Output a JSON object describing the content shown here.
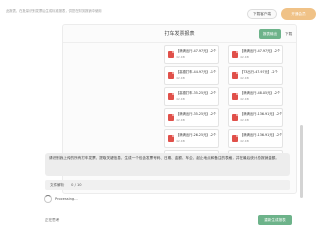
{
  "notice": "此报表，在批量识别发票后生成标准报表，供您在财务报销中使用",
  "header": {
    "download_label": "下载客户端",
    "member_label": "开通会员"
  },
  "panel": {
    "title": "打车发票报表",
    "tabs": {
      "output": "报表输出",
      "download": "下载"
    }
  },
  "files": [
    {
      "name": "【滴滴出行-47.97元】-2个",
      "size": "42.KB"
    },
    {
      "name": "【滴滴出行-47.97元】-2个",
      "size": "42.KB"
    },
    {
      "name": "【高德打车-44.97元】-1个",
      "size": "42.KB"
    },
    {
      "name": "【T3出行-47.97元】-2个",
      "size": "42.KB"
    },
    {
      "name": "【高德打车-35.25元】-2个",
      "size": "42.KB"
    },
    {
      "name": "【滴滴出行-48.05元】-2个",
      "size": "42.KB"
    },
    {
      "name": "【滴滴出行-35.25元】-2个",
      "size": "42.KB"
    },
    {
      "name": "【滴滴出行-136.91元】-2个",
      "size": "42.KB"
    },
    {
      "name": "【滴滴出行-26.25元】-2个",
      "size": "42.KB"
    },
    {
      "name": "【滴滴出行-136.91元】-2个",
      "size": "42.KB"
    },
    {
      "name": "【滴滴出行-47.77元】-2个",
      "size": "42.KB"
    },
    {
      "name": "【滴滴出行-48.77元】-2个",
      "size": "42.KB"
    }
  ],
  "chat": {
    "prompt": "请识别我上传的所有打车发票，提取关键信息，生成一个包含发票号码、日期、金额、车企、起止地点和备注的表格，并在最后统计总报销金额。"
  },
  "progress": {
    "label": "文件解析",
    "count": "0 / 10",
    "processing": "Processing..."
  },
  "footer": {
    "status": "正在思考",
    "restart_label": "重新生成报表"
  }
}
